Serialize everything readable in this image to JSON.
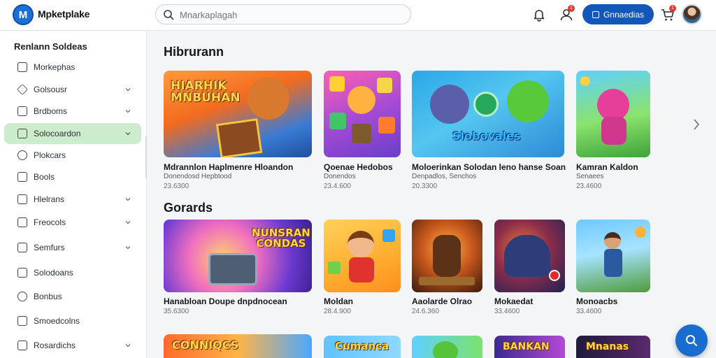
{
  "header": {
    "brand": "Mpketplake",
    "search_placeholder": "Mnarkaplagah",
    "primary_button": "Gnnaedias",
    "notif_badge": "1",
    "cart_badge": "1"
  },
  "sidebar": {
    "title": "Renlann Soldeas",
    "items": [
      {
        "label": "Morkephas",
        "icon": "square-check-icon",
        "chevron": false
      },
      {
        "label": "Golsousr",
        "icon": "diamond-icon",
        "chevron": true
      },
      {
        "label": "Brdboms",
        "icon": "book-icon",
        "chevron": true
      },
      {
        "label": "Solocoardon",
        "icon": "folder-icon",
        "chevron": true,
        "active": true
      },
      {
        "label": "Plokcars",
        "icon": "circle-icon",
        "chevron": false
      },
      {
        "label": "Bools",
        "icon": "book-icon",
        "chevron": false
      },
      {
        "label": "Hlelrans",
        "icon": "layers-icon",
        "chevron": true
      },
      {
        "label": "Freocols",
        "icon": "tag-icon",
        "chevron": true
      },
      {
        "label": "Semfurs",
        "icon": "grid-icon",
        "chevron": true
      },
      {
        "label": "Solodoans",
        "icon": "list-icon",
        "chevron": false
      },
      {
        "label": "Bonbus",
        "icon": "circle-icon",
        "chevron": false
      },
      {
        "label": "Smoedcolns",
        "icon": "note-icon",
        "chevron": false
      },
      {
        "label": "Rosardichs",
        "icon": "box-icon",
        "chevron": true
      }
    ]
  },
  "sections": [
    {
      "title": "Hibrurann",
      "cards": [
        {
          "thumb_text": "HIARHIK\nMNBUHAN",
          "name": "Mdrannlon Haplmenre Hloandon",
          "sub": "Donendosd Hepbtood",
          "price": "23.6300"
        },
        {
          "thumb_text": "",
          "name": "Qoenae Hedobos",
          "sub": "Donendos",
          "price": "23.4.600"
        },
        {
          "thumb_text": "Slobovales",
          "name": "Moloerinkan Solodan leno hanse Soan",
          "sub": "Denpadlos, Senchos",
          "price": "20.3300"
        },
        {
          "thumb_text": "",
          "name": "Kamran Kaldon",
          "sub": "Senaees",
          "price": "23.4600"
        }
      ]
    },
    {
      "title": "Gorards",
      "cards": [
        {
          "thumb_text": "NUNSRAN\nCONDAS",
          "name": "Hanabloan Doupe dnpdnocean",
          "sub": "",
          "price": "35.6300"
        },
        {
          "thumb_text": "",
          "name": "Moldan",
          "sub": "",
          "price": "28.4.900"
        },
        {
          "thumb_text": "",
          "name": "Aaolarde Olrao",
          "sub": "",
          "price": "24.6.360"
        },
        {
          "thumb_text": "",
          "name": "Mokaedat",
          "sub": "",
          "price": "33.4600"
        },
        {
          "thumb_text": "",
          "name": "Monoacbs",
          "sub": "",
          "price": "33.4600"
        }
      ]
    },
    {
      "cards": [
        {
          "thumb_text": "CONNIQCS",
          "name": "",
          "sub": "",
          "price": ""
        },
        {
          "thumb_text": "Cumanca",
          "name": "",
          "sub": "",
          "price": ""
        },
        {
          "thumb_text": "",
          "name": "",
          "sub": "",
          "price": ""
        },
        {
          "thumb_text": "BANKAN",
          "name": "",
          "sub": "",
          "price": ""
        },
        {
          "thumb_text": "Mnanas",
          "name": "",
          "sub": "",
          "price": ""
        }
      ]
    }
  ]
}
